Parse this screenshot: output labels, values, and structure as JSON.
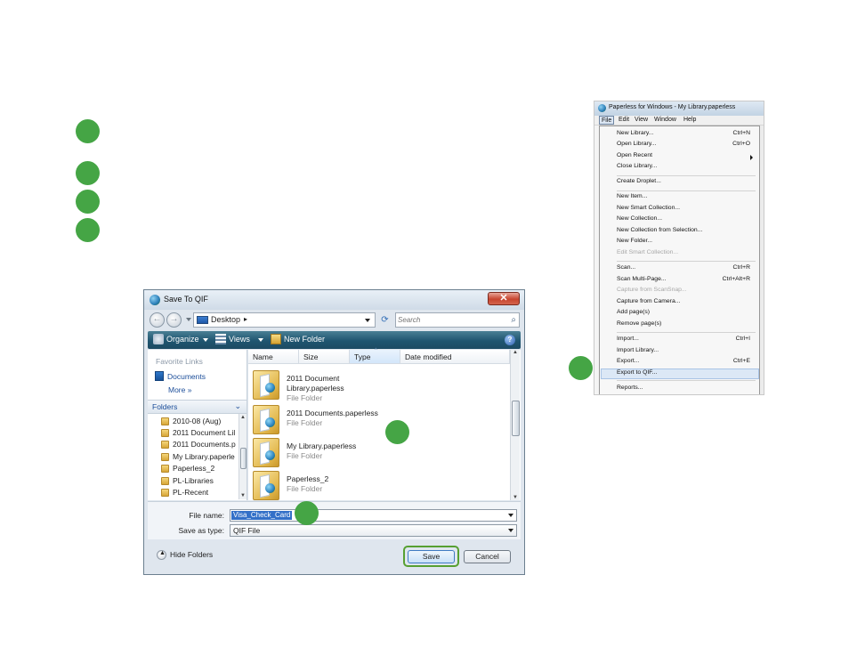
{
  "dialog": {
    "title": "Save To QIF",
    "close_label": "✕",
    "nav": {
      "back": "←",
      "forward": "→"
    },
    "address": {
      "location": "Desktop",
      "crumb_arrow": "▸"
    },
    "search_placeholder": "Search",
    "toolbar": {
      "organize": "Organize",
      "views": "Views",
      "new_folder": "New Folder",
      "help": "?"
    },
    "favorites": {
      "heading": "Favorite Links",
      "documents": "Documents",
      "more": "More",
      "more_glyph": "»"
    },
    "folders_label": "Folders",
    "folders_chevron": "⌄",
    "tree_items": [
      "2010-08 (Aug)",
      "2011 Document Lil",
      "2011 Documents.p",
      "My Library.paperle",
      "Paperless_2",
      "PL-Libraries",
      "PL-Recent"
    ],
    "columns": [
      "Name",
      "Size",
      "Type",
      "Date modified"
    ],
    "files": [
      {
        "name": "2011 Document Library.paperless",
        "kind": "File Folder"
      },
      {
        "name": "2011 Documents.paperless",
        "kind": "File Folder"
      },
      {
        "name": "My Library.paperless",
        "kind": "File Folder"
      },
      {
        "name": "Paperless_2",
        "kind": "File Folder"
      }
    ],
    "file_name_label": "File name:",
    "file_name_value": "Visa_Check_Card",
    "save_type_label": "Save as type:",
    "save_type_value": "QIF File",
    "hide_folders": "Hide Folders",
    "save_button": "Save",
    "cancel_button": "Cancel"
  },
  "menu_window": {
    "title": "Paperless for Windows - My Library.paperless",
    "menubar": [
      "File",
      "Edit",
      "View",
      "Window",
      "Help"
    ],
    "groups": [
      [
        {
          "label": "New Library...",
          "shortcut": "Ctrl+N"
        },
        {
          "label": "Open Library...",
          "shortcut": "Ctrl+O"
        },
        {
          "label": "Open Recent",
          "shortcut": "",
          "submenu": true
        },
        {
          "label": "Close Library...",
          "shortcut": ""
        }
      ],
      [
        {
          "label": "Create Droplet...",
          "shortcut": ""
        }
      ],
      [
        {
          "label": "New Item...",
          "shortcut": ""
        },
        {
          "label": "New Smart Collection...",
          "shortcut": ""
        },
        {
          "label": "New Collection...",
          "shortcut": ""
        },
        {
          "label": "New Collection from Selection...",
          "shortcut": ""
        },
        {
          "label": "New Folder...",
          "shortcut": ""
        },
        {
          "label": "Edit Smart Collection...",
          "shortcut": "",
          "disabled": true
        }
      ],
      [
        {
          "label": "Scan...",
          "shortcut": "Ctrl+R"
        },
        {
          "label": "Scan Multi-Page...",
          "shortcut": "Ctrl+Alt+R"
        },
        {
          "label": "Capture from ScanSnap...",
          "shortcut": "",
          "disabled": true
        },
        {
          "label": "Capture from Camera...",
          "shortcut": ""
        },
        {
          "label": "Add page(s)",
          "shortcut": ""
        },
        {
          "label": "Remove page(s)",
          "shortcut": ""
        }
      ],
      [
        {
          "label": "Import...",
          "shortcut": "Ctrl+I"
        },
        {
          "label": "Import Library...",
          "shortcut": ""
        },
        {
          "label": "Export...",
          "shortcut": "Ctrl+E"
        },
        {
          "label": "Export to QIF...",
          "shortcut": "",
          "highlighted": true
        }
      ],
      [
        {
          "label": "Reports...",
          "shortcut": ""
        }
      ]
    ]
  },
  "colors": {
    "step_marker": "#45a545",
    "save_ring": "#57a032",
    "toolbar": "#1f5570",
    "selection": "#3370c8"
  },
  "icons": [
    "app-globe-icon",
    "close-icon",
    "back-icon",
    "forward-icon",
    "desktop-icon",
    "refresh-icon",
    "search-icon",
    "organize-icon",
    "views-icon",
    "new-folder-icon",
    "help-icon",
    "documents-icon",
    "folder-icon",
    "expand-icon",
    "dropdown-arrow-icon",
    "submenu-arrow-icon"
  ]
}
